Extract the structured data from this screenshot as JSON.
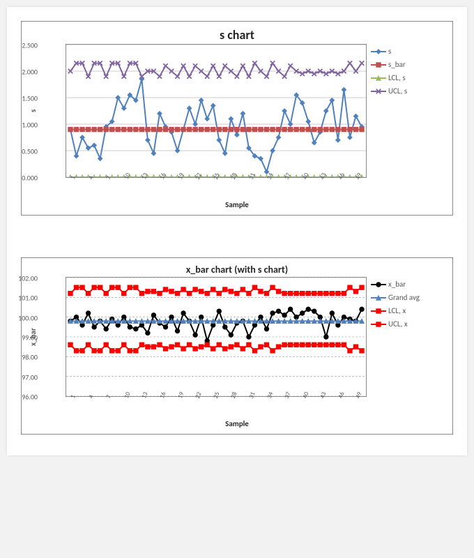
{
  "chart_data": [
    {
      "id": "s-chart",
      "type": "line",
      "title": "s chart",
      "xlabel": "Sample",
      "ylabel": "s",
      "ylim": [
        0.0,
        2.5
      ],
      "yticks": [
        0.0,
        0.5,
        1.0,
        1.5,
        2.0,
        2.5
      ],
      "ytick_labels": [
        "0.000",
        "0.500",
        "1.000",
        "1.500",
        "2.000",
        "2.500"
      ],
      "x": [
        1,
        2,
        3,
        4,
        5,
        6,
        7,
        8,
        9,
        10,
        11,
        12,
        13,
        14,
        15,
        16,
        17,
        18,
        19,
        20,
        21,
        22,
        23,
        24,
        25,
        26,
        27,
        28,
        29,
        30,
        31,
        32,
        33,
        34,
        35,
        36,
        37,
        38,
        39,
        40,
        41,
        42,
        43,
        44,
        45,
        46,
        47,
        48,
        49,
        50
      ],
      "xtick_labels": [
        "1",
        "",
        "",
        "4",
        "",
        "",
        "7",
        "",
        "",
        "10",
        "",
        "",
        "13",
        "",
        "",
        "16",
        "",
        "",
        "19",
        "",
        "",
        "22",
        "",
        "",
        "25",
        "",
        "",
        "28",
        "",
        "",
        "31",
        "",
        "",
        "34",
        "",
        "",
        "37",
        "",
        "",
        "40",
        "",
        "",
        "43",
        "",
        "",
        "46",
        "",
        "",
        "49",
        ""
      ],
      "series": [
        {
          "name": "s",
          "type": "line",
          "marker": "diamond",
          "color": "#4F81BD",
          "values": [
            0.9,
            0.4,
            0.75,
            0.55,
            0.6,
            0.35,
            0.95,
            1.05,
            1.5,
            1.3,
            1.55,
            1.45,
            1.85,
            0.7,
            0.45,
            1.2,
            0.95,
            0.85,
            0.5,
            0.9,
            1.3,
            1.0,
            1.45,
            1.1,
            1.35,
            0.7,
            0.45,
            1.1,
            0.8,
            1.2,
            0.55,
            0.4,
            0.35,
            0.1,
            0.5,
            0.75,
            1.25,
            1.0,
            1.55,
            1.4,
            1.05,
            0.65,
            0.85,
            1.25,
            1.45,
            0.7,
            1.65,
            0.75,
            1.15,
            0.95
          ]
        },
        {
          "name": "s_bar",
          "type": "line",
          "marker": "square",
          "color": "#C0504D",
          "values": [
            0.9,
            0.9,
            0.9,
            0.9,
            0.9,
            0.9,
            0.9,
            0.9,
            0.9,
            0.9,
            0.9,
            0.9,
            0.9,
            0.9,
            0.9,
            0.9,
            0.9,
            0.9,
            0.9,
            0.9,
            0.9,
            0.9,
            0.9,
            0.9,
            0.9,
            0.9,
            0.9,
            0.9,
            0.9,
            0.9,
            0.9,
            0.9,
            0.9,
            0.9,
            0.9,
            0.9,
            0.9,
            0.9,
            0.9,
            0.9,
            0.9,
            0.9,
            0.9,
            0.9,
            0.9,
            0.9,
            0.9,
            0.9,
            0.9,
            0.9
          ]
        },
        {
          "name": "LCL, s",
          "type": "line",
          "marker": "triangle",
          "color": "#9BBB59",
          "values": [
            0,
            0,
            0,
            0,
            0,
            0,
            0,
            0,
            0,
            0,
            0,
            0,
            0,
            0,
            0,
            0,
            0,
            0,
            0,
            0,
            0,
            0,
            0,
            0,
            0,
            0,
            0,
            0,
            0,
            0,
            0,
            0,
            0,
            0,
            0,
            0,
            0,
            0,
            0,
            0,
            0,
            0,
            0,
            0,
            0,
            0,
            0,
            0,
            0,
            0
          ]
        },
        {
          "name": "UCL, s",
          "type": "line",
          "marker": "x",
          "color": "#8064A2",
          "values": [
            2.0,
            2.15,
            2.15,
            1.9,
            2.15,
            2.15,
            1.9,
            2.15,
            2.15,
            1.9,
            2.15,
            2.15,
            1.9,
            2.0,
            2.0,
            1.9,
            2.1,
            2.0,
            1.9,
            2.1,
            1.9,
            2.1,
            2.0,
            1.9,
            2.1,
            1.9,
            2.1,
            2.0,
            1.9,
            2.1,
            1.9,
            2.15,
            2.0,
            1.9,
            2.15,
            2.0,
            1.9,
            2.1,
            2.0,
            1.95,
            2.0,
            1.95,
            2.0,
            1.95,
            2.0,
            1.95,
            2.0,
            2.15,
            2.0,
            2.15
          ]
        }
      ],
      "legend": [
        "s",
        "s_bar",
        "LCL, s",
        "UCL, s"
      ]
    },
    {
      "id": "xbar-chart",
      "type": "line",
      "title": "x_bar chart (with s chart)",
      "xlabel": "Sample",
      "ylabel": "x_bar",
      "ylim": [
        96.0,
        102.0
      ],
      "yticks": [
        96.0,
        97.0,
        98.0,
        99.0,
        100.0,
        101.0,
        102.0
      ],
      "ytick_labels": [
        "96.00",
        "97.00",
        "98.00",
        "99.00",
        "100.00",
        "101.00",
        "102.00"
      ],
      "x": [
        1,
        2,
        3,
        4,
        5,
        6,
        7,
        8,
        9,
        10,
        11,
        12,
        13,
        14,
        15,
        16,
        17,
        18,
        19,
        20,
        21,
        22,
        23,
        24,
        25,
        26,
        27,
        28,
        29,
        30,
        31,
        32,
        33,
        34,
        35,
        36,
        37,
        38,
        39,
        40,
        41,
        42,
        43,
        44,
        45,
        46,
        47,
        48,
        49,
        50
      ],
      "xtick_labels": [
        "1",
        "",
        "",
        "4",
        "",
        "",
        "7",
        "",
        "",
        "10",
        "",
        "",
        "13",
        "",
        "",
        "16",
        "",
        "",
        "19",
        "",
        "",
        "22",
        "",
        "",
        "25",
        "",
        "",
        "28",
        "",
        "",
        "31",
        "",
        "",
        "34",
        "",
        "",
        "37",
        "",
        "",
        "40",
        "",
        "",
        "43",
        "",
        "",
        "46",
        "",
        "",
        "49",
        ""
      ],
      "series": [
        {
          "name": "x_bar",
          "type": "line",
          "marker": "circle",
          "color": "#000000",
          "values": [
            99.8,
            100.0,
            99.6,
            100.2,
            99.5,
            99.8,
            99.4,
            99.9,
            99.6,
            100.0,
            99.5,
            99.4,
            99.6,
            99.2,
            100.1,
            99.7,
            99.5,
            100.0,
            99.3,
            100.2,
            99.8,
            99.1,
            100.0,
            98.8,
            99.6,
            100.3,
            99.5,
            99.1,
            99.7,
            99.8,
            99.0,
            99.6,
            100.0,
            99.4,
            100.2,
            100.3,
            100.1,
            100.4,
            100.0,
            100.2,
            100.4,
            100.3,
            100.0,
            99.0,
            100.2,
            99.6,
            100.0,
            99.9,
            99.8,
            100.4
          ]
        },
        {
          "name": "Grand avg",
          "type": "line",
          "marker": "triangle",
          "color": "#4F81BD",
          "values": [
            99.8,
            99.8,
            99.8,
            99.8,
            99.8,
            99.8,
            99.8,
            99.8,
            99.8,
            99.8,
            99.8,
            99.8,
            99.8,
            99.8,
            99.8,
            99.8,
            99.8,
            99.8,
            99.8,
            99.8,
            99.8,
            99.8,
            99.8,
            99.8,
            99.8,
            99.8,
            99.8,
            99.8,
            99.8,
            99.8,
            99.8,
            99.8,
            99.8,
            99.8,
            99.8,
            99.8,
            99.8,
            99.8,
            99.8,
            99.8,
            99.8,
            99.8,
            99.8,
            99.8,
            99.8,
            99.8,
            99.8,
            99.8,
            99.8,
            99.8
          ]
        },
        {
          "name": "LCL, x",
          "type": "line",
          "marker": "square",
          "color": "#FF0000",
          "values": [
            98.6,
            98.3,
            98.3,
            98.6,
            98.3,
            98.3,
            98.6,
            98.3,
            98.3,
            98.6,
            98.3,
            98.3,
            98.6,
            98.5,
            98.5,
            98.6,
            98.4,
            98.5,
            98.6,
            98.4,
            98.6,
            98.4,
            98.5,
            98.6,
            98.4,
            98.6,
            98.4,
            98.5,
            98.6,
            98.4,
            98.6,
            98.3,
            98.5,
            98.6,
            98.3,
            98.5,
            98.6,
            98.6,
            98.6,
            98.6,
            98.6,
            98.6,
            98.6,
            98.6,
            98.6,
            98.6,
            98.6,
            98.3,
            98.5,
            98.3
          ]
        },
        {
          "name": "UCL, x",
          "type": "line",
          "marker": "square",
          "color": "#FF0000",
          "values": [
            101.2,
            101.5,
            101.5,
            101.2,
            101.5,
            101.5,
            101.2,
            101.5,
            101.5,
            101.2,
            101.5,
            101.5,
            101.2,
            101.3,
            101.3,
            101.2,
            101.4,
            101.3,
            101.2,
            101.4,
            101.2,
            101.4,
            101.3,
            101.2,
            101.4,
            101.2,
            101.4,
            101.3,
            101.2,
            101.4,
            101.2,
            101.5,
            101.3,
            101.2,
            101.5,
            101.3,
            101.2,
            101.2,
            101.2,
            101.2,
            101.2,
            101.2,
            101.2,
            101.2,
            101.2,
            101.2,
            101.2,
            101.5,
            101.3,
            101.5
          ]
        }
      ],
      "legend": [
        "x_bar",
        "Grand avg",
        "LCL, x",
        "UCL, x"
      ]
    }
  ]
}
